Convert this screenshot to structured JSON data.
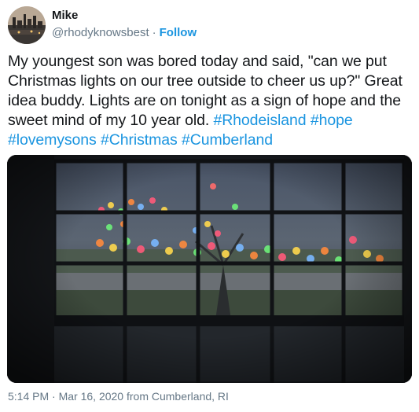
{
  "author": {
    "name": "Mike",
    "handle": "@rhodyknowsbest",
    "separator": "·",
    "follow_label": "Follow"
  },
  "tweet": {
    "text_part1": "My youngest son was bored today and said, \"can we put Christmas lights on our tree outside to cheer us up?\" Great idea buddy. Lights are on tonight as a sign of hope and the sweet mind of my 10 year old. ",
    "hashtags": [
      "#Rhodeisland",
      "#hope",
      "#lovemysons",
      "#Christmas",
      "#Cumberland"
    ]
  },
  "meta": {
    "time": "5:14 PM",
    "separator": "·",
    "date": "Mar 16, 2020",
    "location_prefix": "from",
    "location": "Cumberland, RI"
  },
  "colors": {
    "link": "#1b95e0",
    "secondary_text": "#657786",
    "primary_text": "#14171a"
  }
}
